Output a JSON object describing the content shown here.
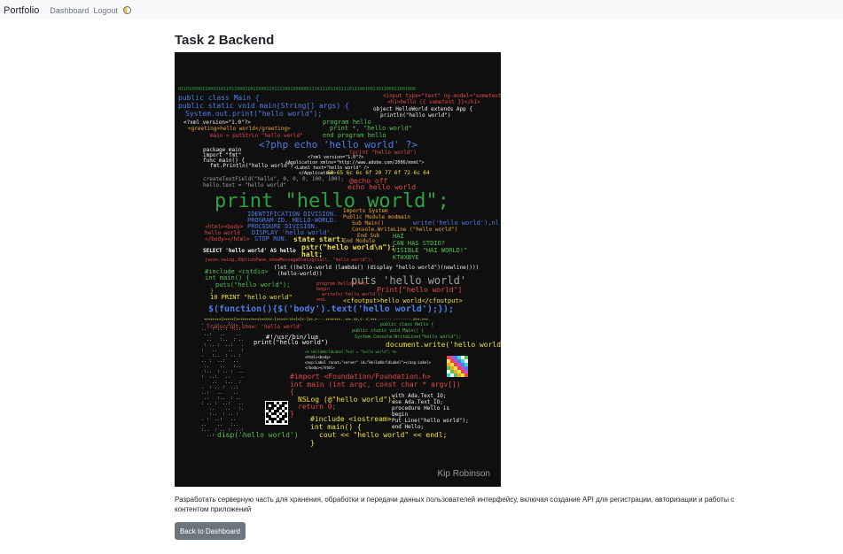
{
  "navbar": {
    "brand": "Portfolio",
    "links": [
      "Dashboard",
      "Logout"
    ],
    "theme_icon": "half-moon-theme-toggle-icon"
  },
  "page": {
    "title": "Task 2 Backend",
    "description": "Разработать серверную часть для хранения, обработки и передачи данных пользователей интерфейсу, включая создание API для регистрации, авторизации и работы с контентом приложений",
    "back_button": "Back to Dashboard"
  },
  "poster": {
    "signature": "Kip Robinson",
    "lines": [
      "01101000011001010110110001101100011011110010000001110111011011110111001001101100011001000",
      "public class Main {",
      "  public static void main(String[] args) {",
      "    System.out.print(\"hello world\");",
      "<input type=\"text\" ng-model=\"sometext\" />",
      "<h1>hello {{ sometext }}</h1>",
      "object HelloWorld extends App {",
      "println(\"hello world\")",
      "<?xml version=\"1.0\"?>",
      "<greeting>hello world</greeting>",
      "program hello",
      "print *, \"hello world\"",
      "end program hello",
      "main = putStrLn \"hello world\"",
      "<?php echo 'hello world' ?>",
      "package main",
      "import \"fmt\"",
      "func main() {",
      "fmt.Println(\"hello world\")",
      "createTextField(\"hello\", 0, 0, 0, 100, 100);",
      "hello.text = \"hello world\"",
      "<?xml version=\"1.0\"?>",
      "<Application xmlns=\"http://www.adobe.com/2006/mxml\">",
      "<Label text=\"hello world\" />",
      "</Application>",
      "(print \"hello world\")",
      "68 65 6c 6c 6f 20 77 6f 72 6c 64",
      "@echo off",
      "echo hello world",
      "print \"hello world\";",
      "IDENTIFICATION DIVISION.",
      "PROGRAM-ID. HELLO-WORLD.",
      "PROCEDURE DIVISION.",
      "DISPLAY 'hello world'.",
      "STOP RUN.",
      "Imports System",
      "Public Module modmain",
      "Sub Main()",
      "Console.WriteLine (\"hello world\")",
      "End Sub",
      "End Module",
      "write('hello world'),nl.",
      "HAI",
      "CAN HAS STDIO?",
      "VISIBLE \"HAI WORLD!\"",
      "KTHXBYE",
      "<html><body>",
      "hello world",
      "</body></html>",
      "state start:",
      "pstr(\"hello world\\n\");",
      "halt;",
      "SELECT 'hello world' AS hello",
      "javax.swing.JOptionPane.showMessageDialog(null, \"hello world\");",
      "#include <cstdio>",
      "int main() {",
      "puts(\"hello world\");",
      "}",
      "(let ((hello-world (lambda() (display \"hello world\")(newline))))",
      "(hello-world))",
      "puts 'hello world'",
      "program HelloWorld;",
      "begin",
      "writeln('hello world');",
      "end.",
      "Print[\"hello world\"]",
      "10 PRINT \"hello world\"",
      "<cfoutput>hello world</cfoutput>",
      "$(function(){$('body').text('hello world');});",
      "++++++++[>++++[>++>+++>+++>+<<<<-]>+>+>->>+[<]<-]>>.>---.+++++++..+++.>>.<-.<.+++.------.--------.>>+.>++.",
      "Transcript show: 'hello world'",
      "#!/usr/bin/lua",
      "print(\"hello world\")",
      "public class Hello {",
      "public static void Main() {",
      "System.Console.WriteLine(\"hello world\");",
      "document.write('hello world');",
      "<% HelloWorldLabel.Text = \"hello world\"; %>",
      "<html><body>",
      "<asp:Label runat=\"server\" id=\"HelloWorldLabel\"></asp:Label>",
      "</body></html>",
      "#import <Foundation/Foundation.h>",
      "int main (int argc, const char * argv[])",
      "{",
      "NSLog (@\"hello world\");",
      "return 0;",
      "}",
      "with Ada.Text_IO;",
      "use Ada.Text_IO;",
      "procedure Hello is",
      "begin",
      "Put_Line(\"hello world\");",
      "end Hello;",
      "#include <iostream>",
      "int main() {",
      "cout << \"hello world\" << endl;",
      "}",
      "disp('hello world')"
    ]
  }
}
